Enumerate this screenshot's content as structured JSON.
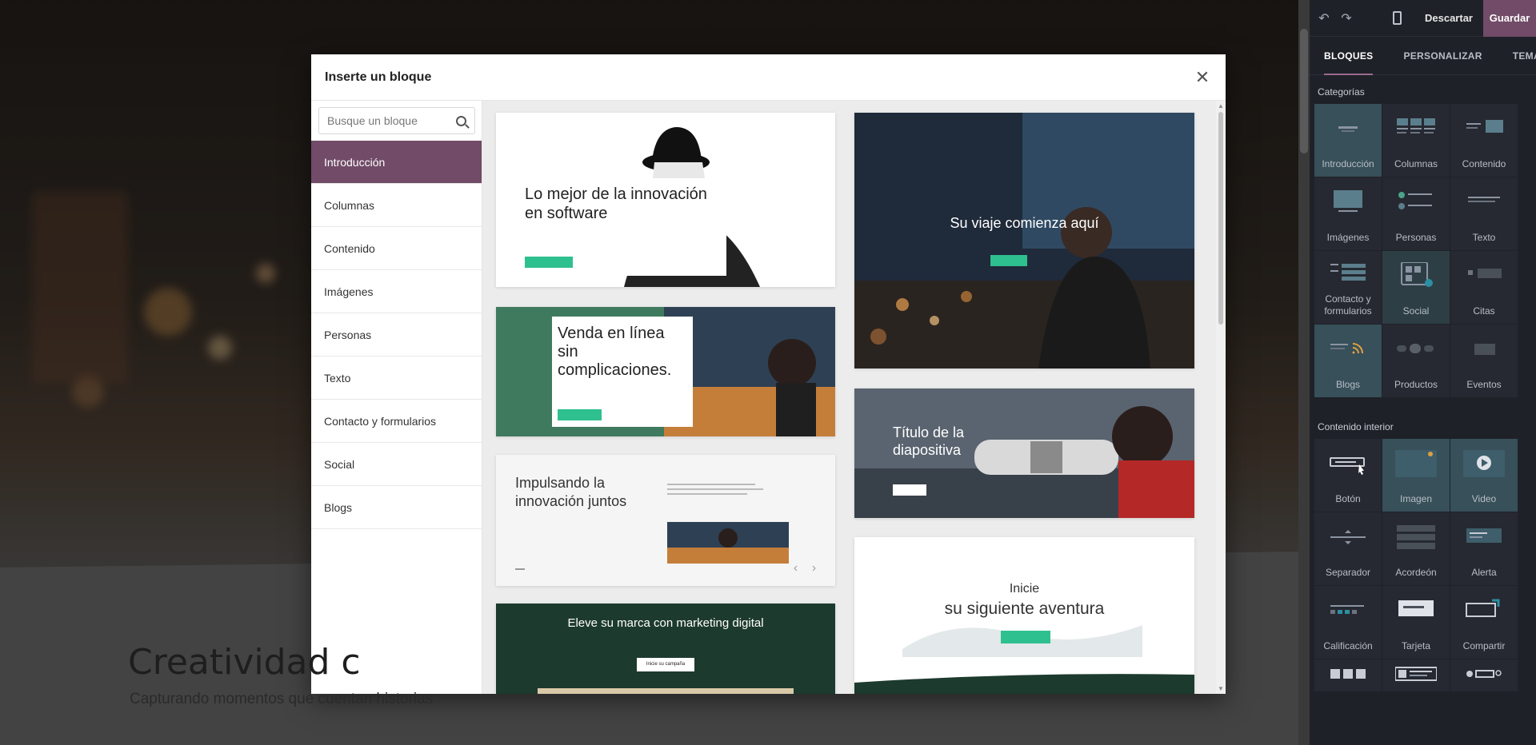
{
  "site": {
    "hero_title": "Creatividad c",
    "hero_subtitle": "Capturando momentos que cuentan historias"
  },
  "editor": {
    "discard_label": "Descartar",
    "save_label": "Guardar",
    "tabs": [
      "BLOQUES",
      "PERSONALIZAR",
      "TEMA"
    ],
    "categories_title": "Categorías",
    "categories": [
      "Introducción",
      "Columnas",
      "Contenido",
      "Imágenes",
      "Personas",
      "Texto",
      "Contacto y formularios",
      "Social",
      "Citas",
      "Blogs",
      "Productos",
      "Eventos"
    ],
    "inner_title": "Contenido interior",
    "inner": [
      "Botón",
      "Imagen",
      "Video",
      "Separador",
      "Acordeón",
      "Alerta",
      "Calificación",
      "Tarjeta",
      "Compartir",
      "",
      "",
      ""
    ]
  },
  "modal": {
    "title": "Inserte un bloque",
    "search_placeholder": "Busque un bloque",
    "categories": [
      "Introducción",
      "Columnas",
      "Contenido",
      "Imágenes",
      "Personas",
      "Texto",
      "Contacto y formularios",
      "Social",
      "Blogs"
    ],
    "active_category": "Introducción",
    "previews": {
      "p1_title": "Lo mejor de la innovación en software",
      "p2_title": "Venda en línea sin complicaciones.",
      "p3_title": "Impulsando la innovación juntos",
      "p4_title": "Eleve su marca con marketing digital",
      "p4_button": "Inicie su campaña",
      "p5_title": "Su viaje comienza aquí",
      "p6_title": "Título de la diapositiva",
      "p7_line1": "Inicie",
      "p7_line2": "su siguiente aventura"
    }
  },
  "colors": {
    "brand": "#714b67",
    "accent_green": "#2ec08f",
    "editor_bg": "#1f2128"
  }
}
